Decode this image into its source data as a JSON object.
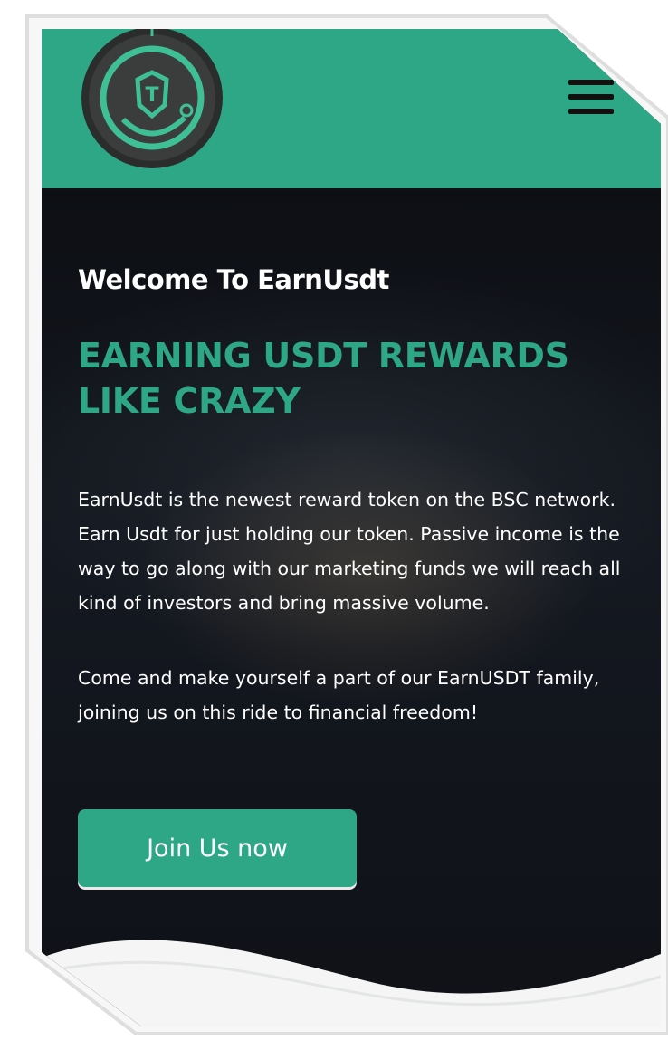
{
  "header": {
    "logo_name": "earnusdt-logo",
    "logo_letter": "T",
    "menu_icon": "hamburger-menu-icon",
    "background_color": "#2ea786"
  },
  "hero": {
    "welcome": "Welcome To EarnUsdt",
    "headline_line1": "EARNING USDT REWARDS",
    "headline_line2": "LIKE CRAZY",
    "paragraph1": "EarnUsdt is the newest reward token on the BSC network. Earn Usdt for just holding our token. Passive income is the way to go along with our marketing funds we will reach all kind of investors and bring massive volume.",
    "paragraph2": "Come and make yourself a part of our EarnUSDT family, joining us on this ride to financial freedom!",
    "cta_label": "Join Us now"
  },
  "colors": {
    "accent": "#2ea786",
    "dark_background": "#0f1117",
    "text": "#ffffff"
  }
}
